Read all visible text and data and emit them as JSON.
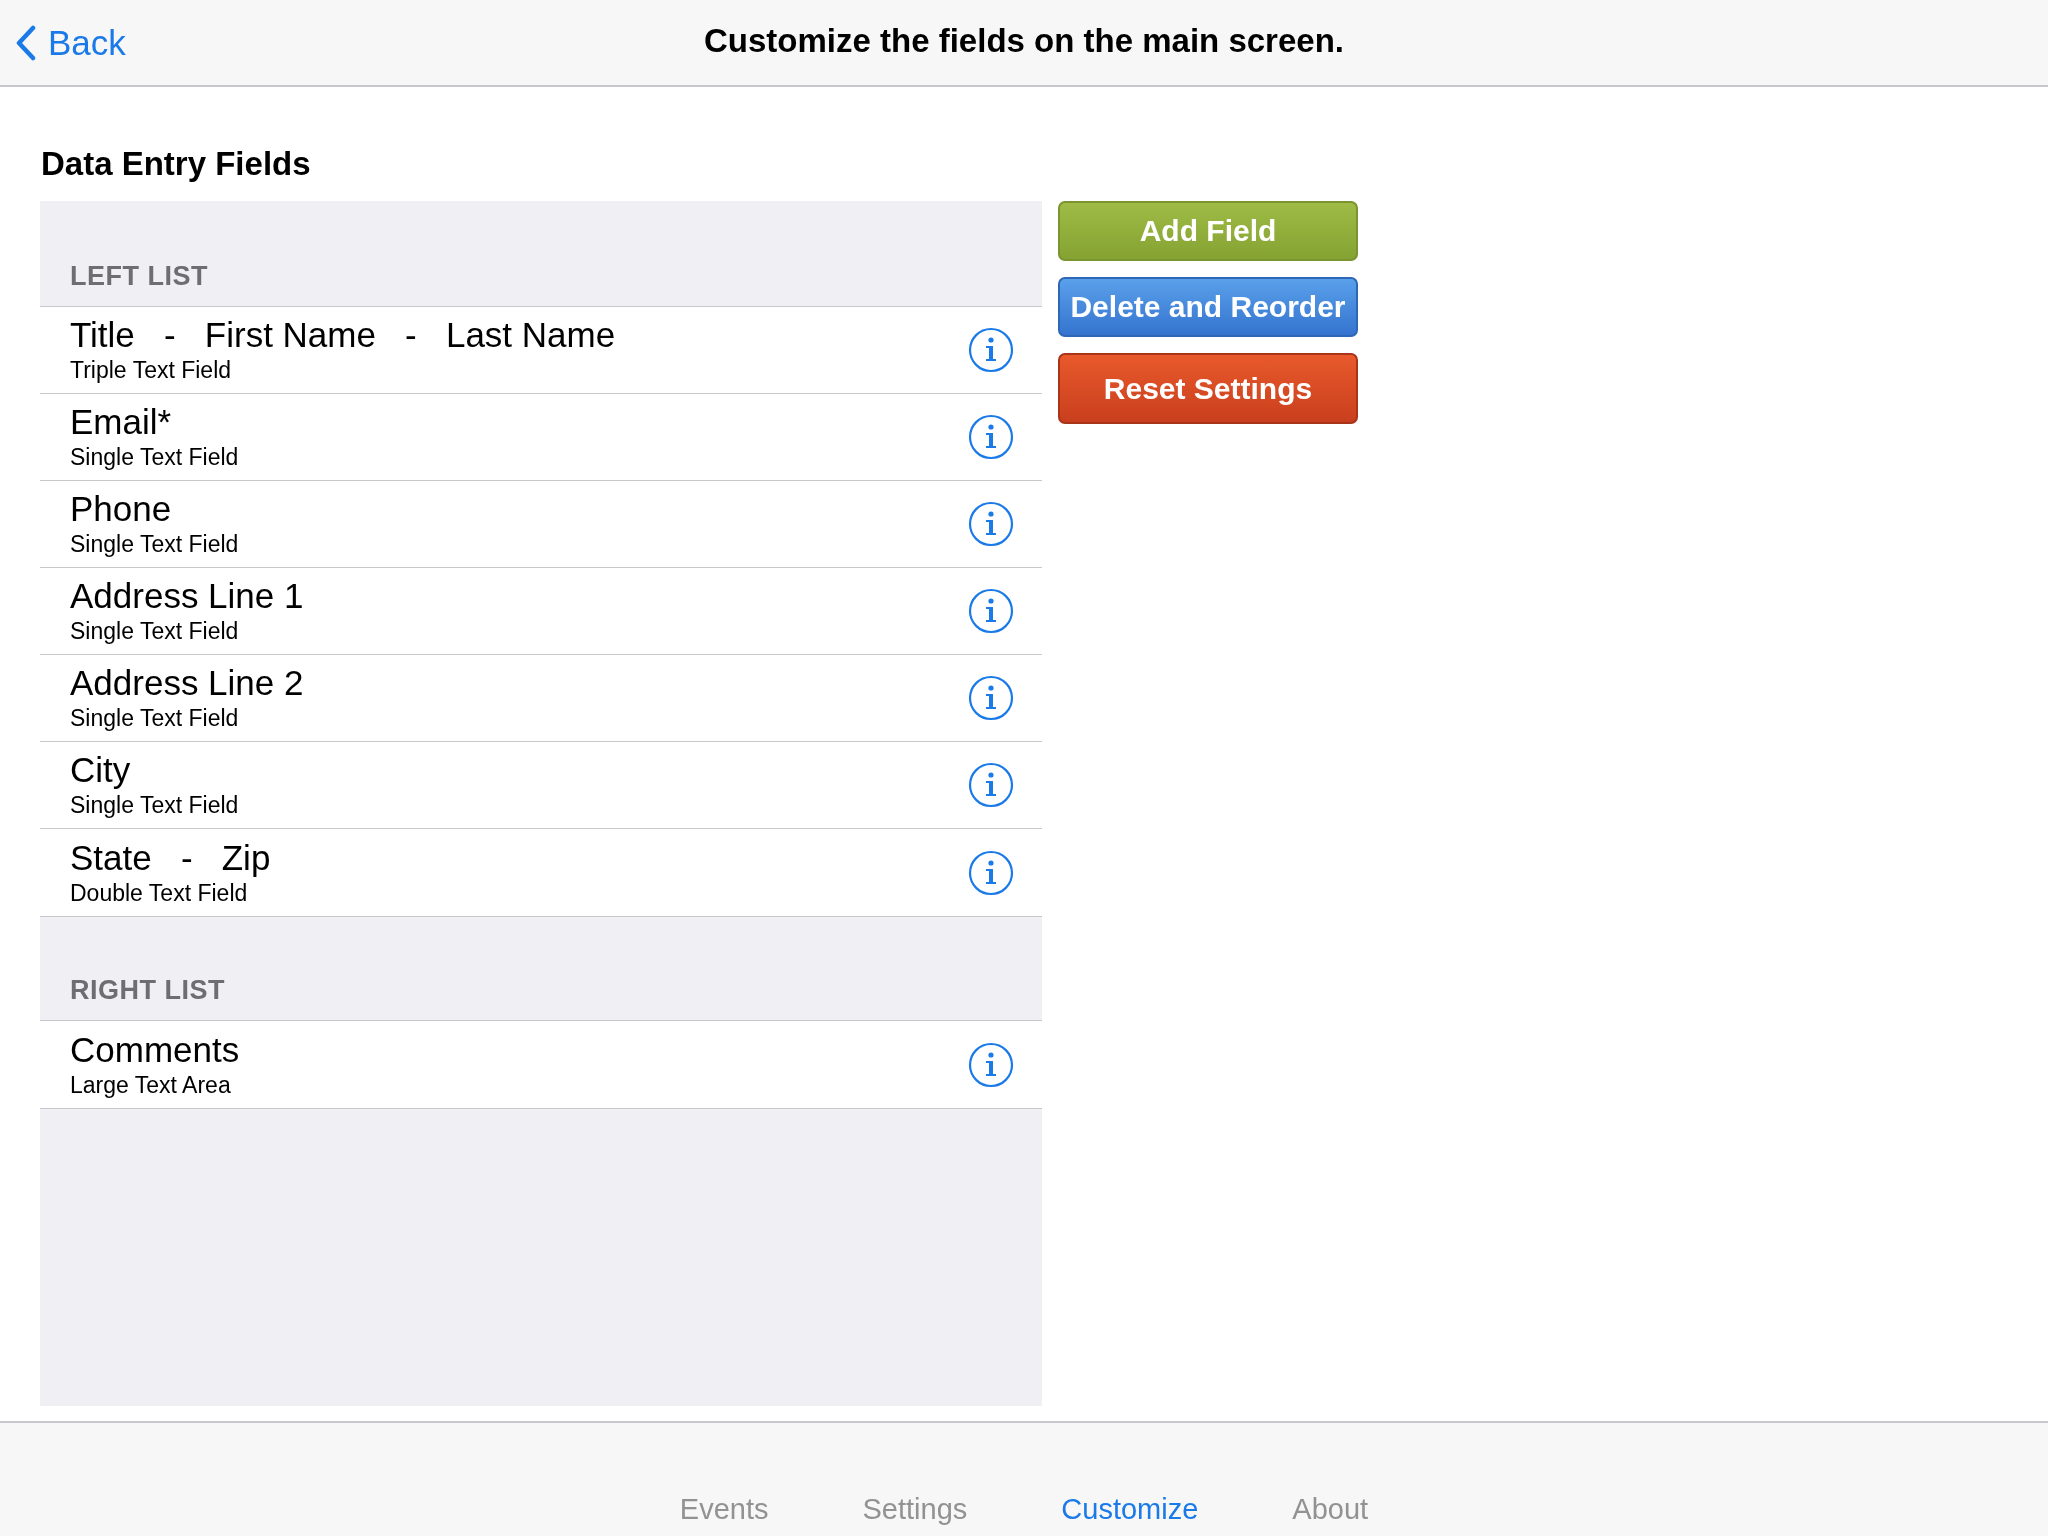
{
  "nav_bar": {
    "back": "Back",
    "title": "Customize the fields on the main screen."
  },
  "heading": "Data Entry Fields",
  "sections": [
    {
      "header": "LEFT LIST",
      "rows": [
        {
          "title": "Title   -   First Name   -   Last Name",
          "subtitle": "Triple Text Field"
        },
        {
          "title": "Email*",
          "subtitle": "Single Text Field"
        },
        {
          "title": "Phone",
          "subtitle": "Single Text Field"
        },
        {
          "title": "Address Line 1",
          "subtitle": "Single Text Field"
        },
        {
          "title": "Address Line 2",
          "subtitle": "Single Text Field"
        },
        {
          "title": "City",
          "subtitle": "Single Text Field"
        },
        {
          "title": "State   -   Zip",
          "subtitle": "Double Text Field"
        }
      ]
    },
    {
      "header": "RIGHT LIST",
      "rows": [
        {
          "title": "Comments",
          "subtitle": "Large Text Area"
        }
      ]
    }
  ],
  "buttons": [
    {
      "label": "Add Field",
      "kind": "add"
    },
    {
      "label": "Delete and Reorder",
      "kind": "reorder"
    },
    {
      "label": "Reset Settings",
      "kind": "reset"
    }
  ],
  "tab_bar": [
    {
      "label": "Events",
      "selected": false
    },
    {
      "label": "Settings",
      "selected": false
    },
    {
      "label": "Customize",
      "selected": true
    },
    {
      "label": "About",
      "selected": false
    }
  ]
}
